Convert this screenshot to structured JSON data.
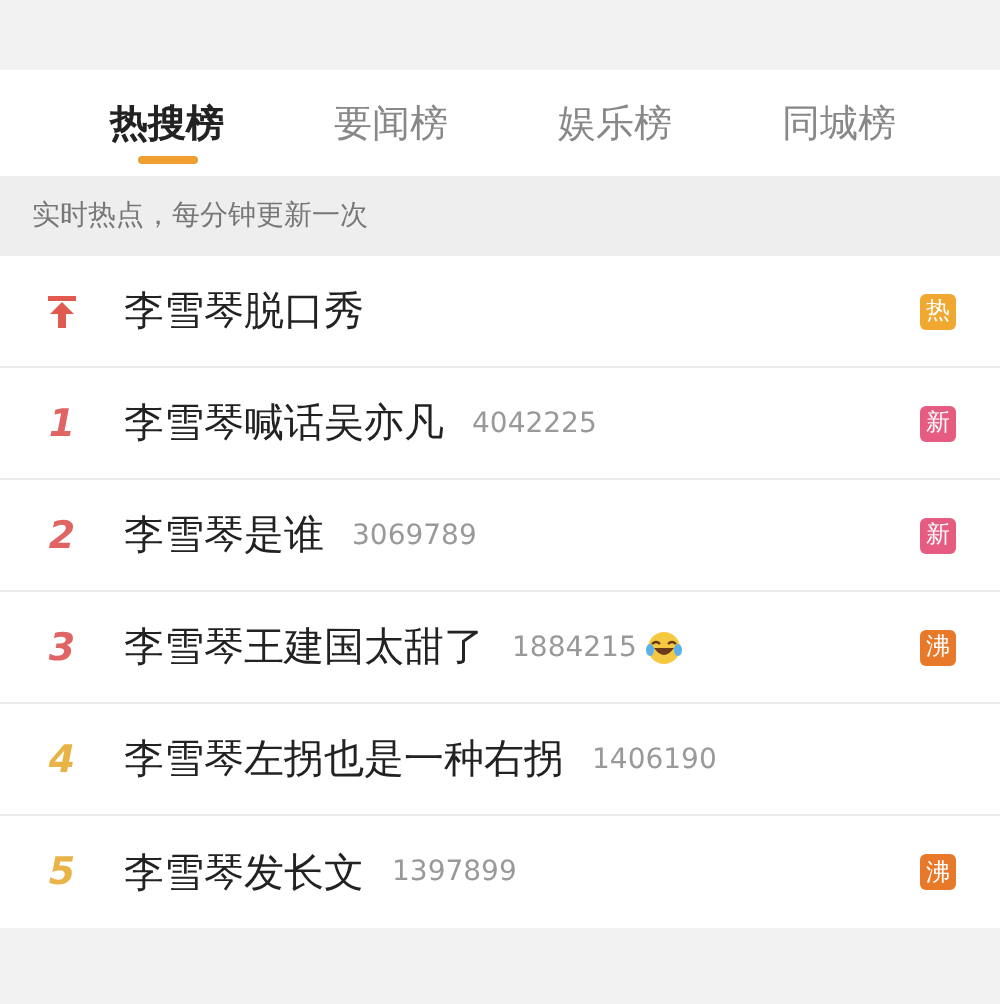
{
  "tabs": [
    {
      "label": "热搜榜",
      "selected": true
    },
    {
      "label": "要闻榜",
      "selected": false
    },
    {
      "label": "娱乐榜",
      "selected": false
    },
    {
      "label": "同城榜",
      "selected": false
    }
  ],
  "notice": "实时热点，每分钟更新一次",
  "rows": [
    {
      "kind": "pinned",
      "title": "李雪琴脱口秀",
      "badge": {
        "label": "热",
        "color": "#f0a830"
      }
    },
    {
      "kind": "ranked",
      "rank": "1",
      "color": "#e06464",
      "title": "李雪琴喊话吴亦凡",
      "count": "4042225",
      "badge": {
        "label": "新",
        "color": "#e65c80"
      }
    },
    {
      "kind": "ranked",
      "rank": "2",
      "color": "#e06464",
      "title": "李雪琴是谁",
      "count": "3069789",
      "badge": {
        "label": "新",
        "color": "#e65c80"
      }
    },
    {
      "kind": "ranked",
      "rank": "3",
      "color": "#e06464",
      "title": "李雪琴王建国太甜了",
      "count": "1884215",
      "emoji": true,
      "badge": {
        "label": "沸",
        "color": "#e8782a"
      }
    },
    {
      "kind": "ranked",
      "rank": "4",
      "color": "#e8b448",
      "title": "李雪琴左拐也是一种右拐",
      "count": "1406190"
    },
    {
      "kind": "ranked",
      "rank": "5",
      "color": "#e8b448",
      "title": "李雪琴发长文",
      "count": "1397899",
      "badge": {
        "label": "沸",
        "color": "#e8782a"
      }
    }
  ]
}
